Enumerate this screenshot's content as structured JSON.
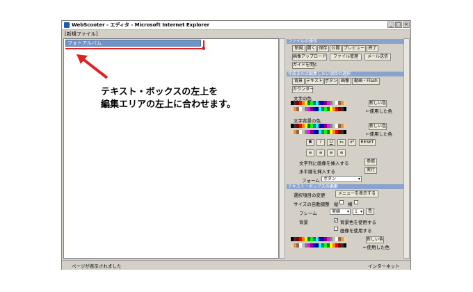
{
  "window": {
    "title": "WebScooter - エディタ - Microsoft Internet Explorer",
    "min_label": "_",
    "max_label": "□",
    "close_label": "×"
  },
  "menu": {
    "label": "[新規ファイル]"
  },
  "editor": {
    "textbox_label": "フォトアルバム"
  },
  "annotation": {
    "line1": "テキスト・ボックスの左上を",
    "line2": "編集エリアの左上に合わせます。"
  },
  "panel": {
    "file_section": "ファイルの操作",
    "file_buttons": [
      "新規",
      "開く",
      "保存",
      "公開",
      "プレビュー",
      "終了"
    ],
    "file_buttons2": [
      "画像アップロード",
      "ファイル管理",
      "メール送信"
    ],
    "guide_button": "ガイドを開く",
    "edit_section": "作成または編集したい項目の選択",
    "edit_buttons": [
      "背景",
      "テキスト",
      "ボタン",
      "画像",
      "動画・Flash"
    ],
    "counter_button": "カウンター",
    "text_color_label": "文字の色",
    "new_color_button": "新しい色",
    "used_color_label": "←使用した色",
    "bg_color_label": "文字背景の色",
    "format_buttons": [
      "B",
      "I",
      "U",
      "x₂",
      "x²",
      "RESET"
    ],
    "align_buttons": [
      "≡",
      "≡",
      "≡",
      "≡"
    ],
    "insert_image_label": "文字列に画像を挿入する",
    "insert_image_button": "参照",
    "hr_label": "水平線を挿入する",
    "hr_button": "実行",
    "form_label": "フォーム",
    "form_select": "ボタン",
    "textbox_section": "テキスト・ボックスの編集",
    "change_item_label": "選択項目の変更",
    "show_menu_button": "メニューを表示する",
    "autosize_label": "サイズの自動調整",
    "vertical_label": "縦",
    "horizontal_label": "横",
    "frame_label": "フレーム",
    "frame_select": "実線",
    "frame_width": "1",
    "frame_color_button": "色",
    "background_label": "背景",
    "use_bg_color_label": "背景色を使用する",
    "use_image_label": "画像を使用する"
  },
  "status": {
    "text": "ページが表示されました",
    "zone": "インターネット"
  },
  "colors": {
    "palette": [
      "#000000",
      "#333333",
      "#800000",
      "#ff0000",
      "#ff8000",
      "#ffff00",
      "#008000",
      "#00ff00",
      "#008080",
      "#00ffff",
      "#000080",
      "#0000ff",
      "#800080",
      "#ff00ff",
      "#808080",
      "#c0c0c0",
      "#ffffff",
      "#996633",
      "#cc9966",
      "#ffcc99"
    ],
    "used": [
      "#4080c0",
      "#ff0000",
      "#ffcc00",
      "#00a000",
      "#000000",
      "#808080"
    ],
    "accent_red": "#e02020"
  }
}
